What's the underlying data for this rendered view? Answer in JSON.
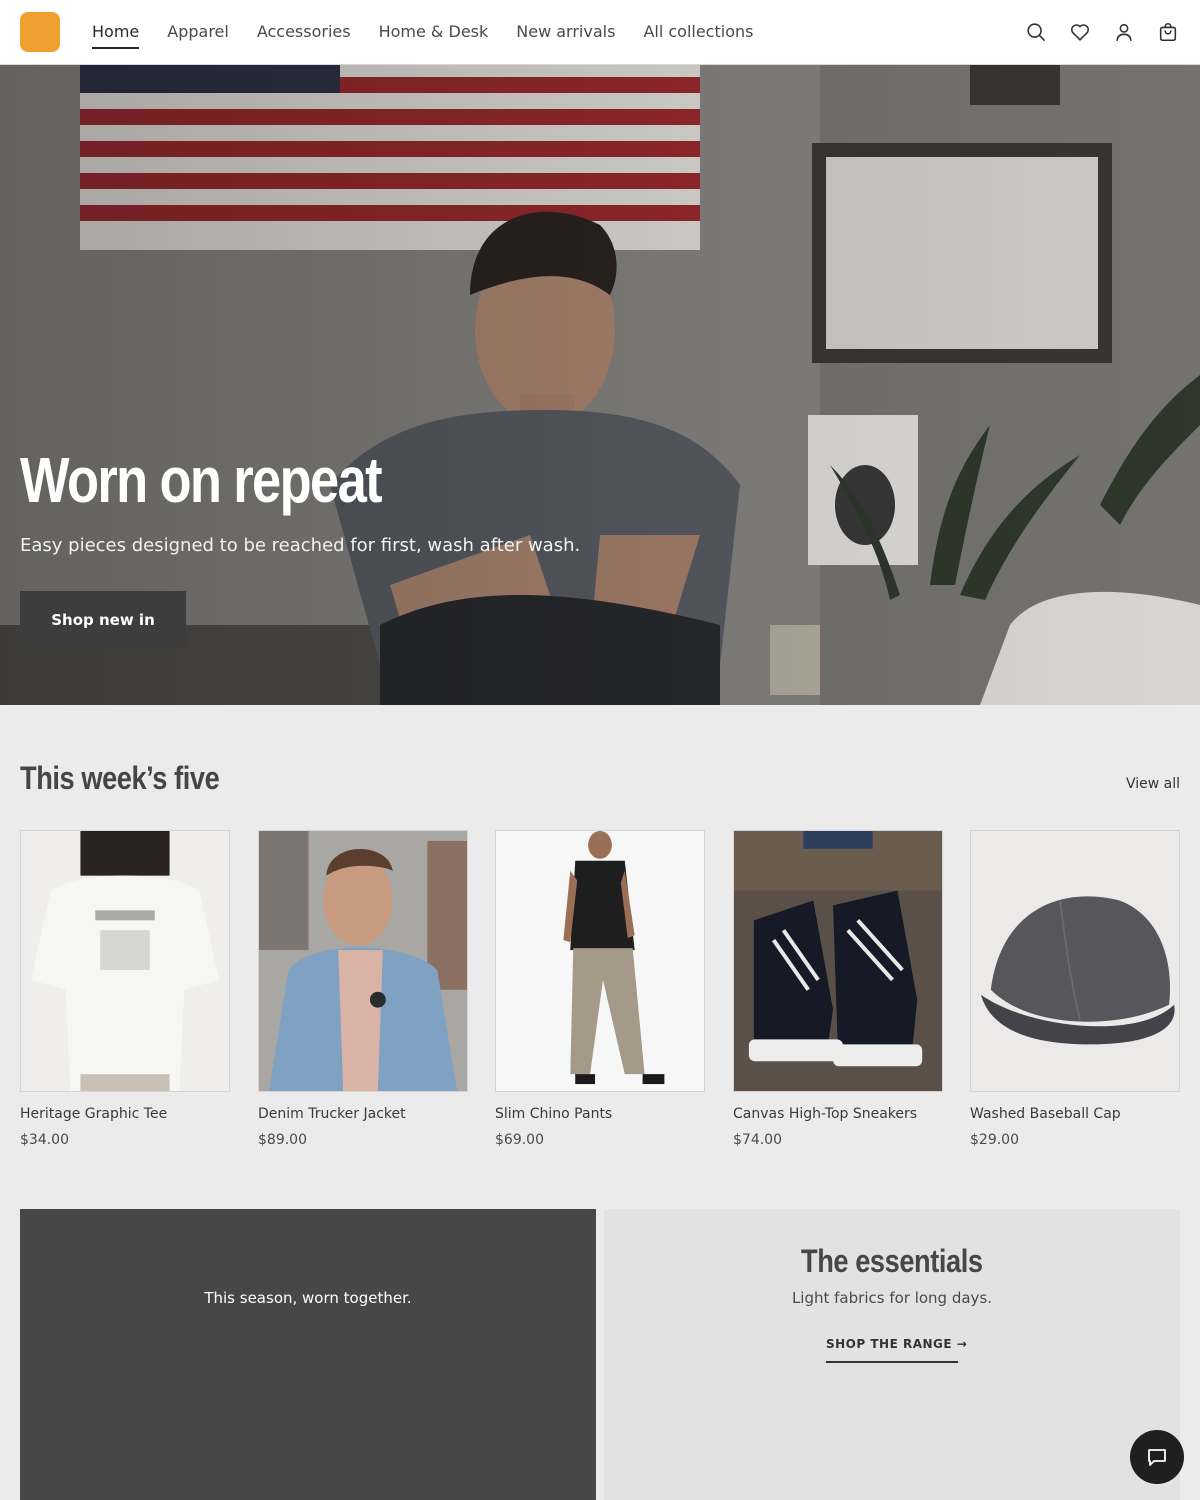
{
  "brand": {
    "logo_color": "#F0A030"
  },
  "nav": {
    "items": [
      {
        "label": "Home",
        "active": true
      },
      {
        "label": "Apparel",
        "active": false
      },
      {
        "label": "Accessories",
        "active": false
      },
      {
        "label": "Home & Desk",
        "active": false
      },
      {
        "label": "New arrivals",
        "active": false
      },
      {
        "label": "All collections",
        "active": false
      }
    ]
  },
  "header_icons": [
    "search-icon",
    "heart-icon",
    "account-icon",
    "cart-icon"
  ],
  "hero": {
    "title": "Worn on repeat",
    "subtitle": "Easy pieces designed to be reached for first, wash after wash.",
    "button_label": "Shop new in",
    "image_alt": "Man in grey t-shirt crouching in a room with a flag and framed prints"
  },
  "featured": {
    "title": "This week’s five",
    "view_all_label": "View all",
    "products": [
      {
        "name": "Heritage Graphic Tee",
        "price": "$34.00"
      },
      {
        "name": "Denim Trucker Jacket",
        "price": "$89.00"
      },
      {
        "name": "Slim Chino Pants",
        "price": "$69.00"
      },
      {
        "name": "Canvas High-Top Sneakers",
        "price": "$74.00"
      },
      {
        "name": "Washed Baseball Cap",
        "price": "$29.00"
      }
    ]
  },
  "promo_dark": {
    "text": "This season, worn together."
  },
  "promo_light": {
    "title": "The essentials",
    "subtitle": "Light fabrics for long days.",
    "link_label": "SHOP THE RANGE →"
  },
  "chat": {
    "icon": "chat-icon"
  }
}
